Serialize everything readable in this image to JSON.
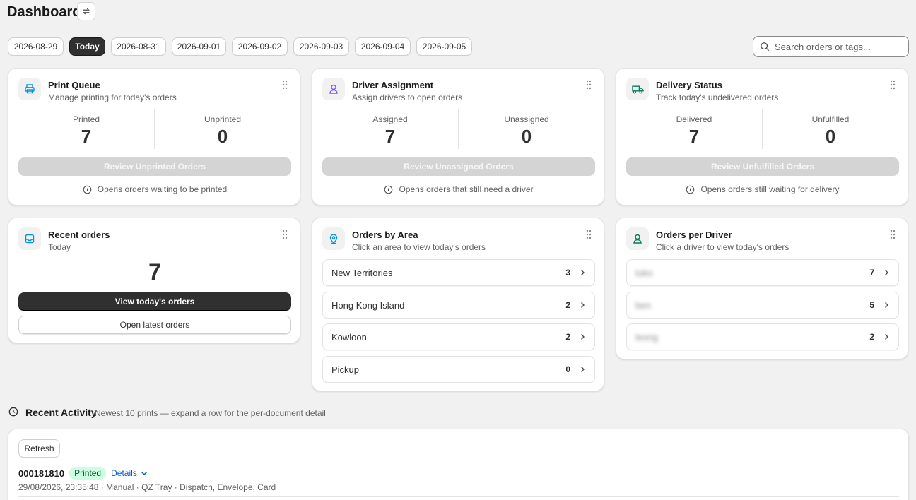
{
  "header": {
    "title": "Dashboard"
  },
  "dates": [
    "2026-08-29",
    "Today",
    "2026-08-31",
    "2026-09-01",
    "2026-09-02",
    "2026-09-03",
    "2026-09-04",
    "2026-09-05"
  ],
  "search": {
    "placeholder": "Search orders or tags..."
  },
  "print_queue": {
    "title": "Print Queue",
    "subtitle": "Manage printing for today's orders",
    "left_label": "Printed",
    "left_value": "7",
    "right_label": "Unprinted",
    "right_value": "0",
    "button": "Review Unprinted Orders",
    "hint": "Opens orders waiting to be printed"
  },
  "driver_assignment": {
    "title": "Driver Assignment",
    "subtitle": "Assign drivers to open orders",
    "left_label": "Assigned",
    "left_value": "7",
    "right_label": "Unassigned",
    "right_value": "0",
    "button": "Review Unassigned Orders",
    "hint": "Opens orders that still need a driver"
  },
  "delivery_status": {
    "title": "Delivery Status",
    "subtitle": "Track today's undelivered orders",
    "left_label": "Delivered",
    "left_value": "7",
    "right_label": "Unfulfilled",
    "right_value": "0",
    "button": "Review Unfulfilled Orders",
    "hint": "Opens orders still waiting for delivery"
  },
  "recent_orders": {
    "title": "Recent orders",
    "subtitle": "Today",
    "value": "7",
    "primary_button": "View today's orders",
    "secondary_button": "Open latest orders"
  },
  "orders_by_area": {
    "title": "Orders by Area",
    "subtitle": "Click an area to view today's orders",
    "rows": [
      {
        "name": "New Territories",
        "count": "3"
      },
      {
        "name": "Hong Kong Island",
        "count": "2"
      },
      {
        "name": "Kowloon",
        "count": "2"
      },
      {
        "name": "Pickup",
        "count": "0"
      }
    ]
  },
  "orders_per_driver": {
    "title": "Orders per Driver",
    "subtitle": "Click a driver to view today's orders",
    "rows": [
      {
        "name": "tuko",
        "count": "7"
      },
      {
        "name": "ben",
        "count": "5"
      },
      {
        "name": "leong",
        "count": "2"
      }
    ]
  },
  "recent_activity": {
    "title": "Recent Activity",
    "subtitle": "Newest 10 prints — expand a row for the per-document detail",
    "refresh": "Refresh",
    "entries": [
      {
        "order": "000181810",
        "status": "Printed",
        "details": "Details",
        "meta": "29/08/2026, 23:35:48 · Manual · QZ Tray · Dispatch, Envelope, Card"
      }
    ]
  },
  "colors": {
    "accent_dark": "#303030",
    "printed_bg": "#cdfee1",
    "link": "#005bd3"
  }
}
